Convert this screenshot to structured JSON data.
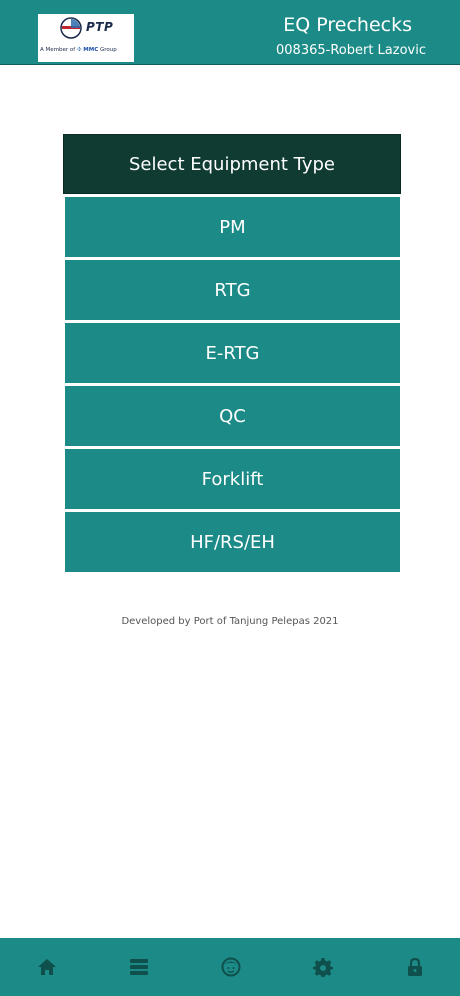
{
  "header": {
    "title": "EQ Prechecks",
    "user": "008365-Robert Lazovic",
    "logo": {
      "brand": "PTP",
      "member_prefix": "A Member of",
      "member_group_name": "MMC",
      "member_group_suffix": "Group"
    }
  },
  "panel": {
    "title": "Select Equipment Type",
    "items": [
      {
        "label": "PM"
      },
      {
        "label": "RTG"
      },
      {
        "label": "E-RTG"
      },
      {
        "label": "QC"
      },
      {
        "label": "Forklift"
      },
      {
        "label": "HF/RS/EH"
      }
    ]
  },
  "footer": {
    "credit": "Developed by Port of Tanjung Pelepas 2021"
  },
  "bottom_nav": {
    "items": [
      {
        "icon": "home-icon"
      },
      {
        "icon": "list-icon"
      },
      {
        "icon": "profile-icon"
      },
      {
        "icon": "gear-icon"
      },
      {
        "icon": "lock-icon"
      }
    ]
  },
  "colors": {
    "primary": "#1c8a86",
    "panel_title_bg": "#0f3b33",
    "nav_icon": "#0f4f4c"
  }
}
